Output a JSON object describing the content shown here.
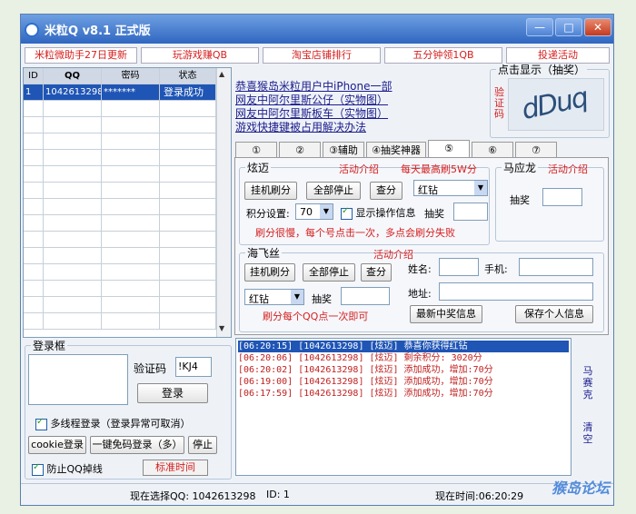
{
  "window": {
    "title": "米粒Q  v8.1  正式版",
    "controls": [
      "—",
      "□",
      "✕"
    ]
  },
  "links": [
    "米粒微助手27日更新",
    "玩游戏赚QB",
    "淘宝店铺排行",
    "五分钟领1QB",
    "投递活动"
  ],
  "account_table": {
    "headers": [
      "ID",
      "QQ",
      "密码",
      "状态"
    ],
    "rows": [
      [
        "1",
        "1042613298",
        "*******",
        "登录成功"
      ]
    ]
  },
  "captcha_box": {
    "legend": "点击显示（抽奖）",
    "side_label": "验证码",
    "code_image_text": "dDuq"
  },
  "news": [
    "恭喜猴岛米粒用户中iPhone一部",
    "网友中阿尔里斯公仔（实物图）",
    "网友中阿尔里斯板车（实物图）",
    "游戏快捷键被占用解决办法"
  ],
  "tabs": [
    "①",
    "②",
    "③辅助",
    "④抽奖神器",
    "⑤",
    "⑥",
    "⑦"
  ],
  "xuanmai": {
    "legend": "炫迈",
    "promo": "活动介绍",
    "note": "每天最高刷5W分",
    "btn_hang": "挂机刷分",
    "btn_stopall": "全部停止",
    "btn_query": "查分",
    "select_reward": "红钻",
    "score_label": "积分设置:",
    "score_value": "70",
    "show_info": "显示操作信息",
    "draw_label": "抽奖",
    "warning": "刷分很慢，每个号点击一次，多点会刷分失败"
  },
  "mayinglong": {
    "legend": "马应龙",
    "promo": "活动介绍",
    "draw_label": "抽奖"
  },
  "haifeisi": {
    "legend": "海飞丝",
    "promo": "活动介绍",
    "btn_hang": "挂机刷分",
    "btn_stopall": "全部停止",
    "btn_query": "查分",
    "select_reward": "红钻",
    "draw_label": "抽奖",
    "note": "刷分每个QQ点一次即可",
    "name_label": "姓名:",
    "phone_label": "手机:",
    "addr_label": "地址:",
    "btn_latest": "最新中奖信息",
    "btn_save": "保存个人信息"
  },
  "login": {
    "legend": "登录框",
    "captcha_label": "验证码",
    "captcha_value": "!KJ4",
    "btn_login": "登录",
    "multithread": "多线程登录（登录异常可取消）",
    "btn_cookie": "cookie登录",
    "btn_nopw": "一键免码登录（多）",
    "btn_stop": "停止",
    "prevent_drop": "防止QQ掉线",
    "std_time": "标准时间"
  },
  "log": [
    {
      "text": "[06:20:15] [1042613298] [炫迈] 恭喜你获得红钻",
      "highlight": true
    },
    {
      "text": "[06:20:06] [1042613298] [炫迈] 剩余积分: 3020分",
      "highlight": false
    },
    {
      "text": "[06:20:02] [1042613298] [炫迈] 添加成功，增加:70分",
      "highlight": false
    },
    {
      "text": "[06:19:00] [1042613298] [炫迈] 添加成功，增加:70分",
      "highlight": false
    },
    {
      "text": "[06:17:59] [1042613298] [炫迈] 添加成功，增加:70分",
      "highlight": false
    }
  ],
  "side_links": {
    "top": "马赛克",
    "bottom": "清空"
  },
  "status": {
    "current_qq": "现在选择QQ: 1042613298",
    "id": "ID: 1",
    "time": "现在时间:06:20:29"
  },
  "watermark": "猴岛论坛"
}
